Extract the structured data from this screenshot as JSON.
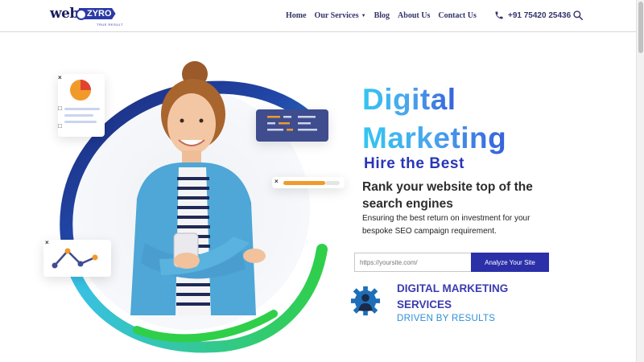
{
  "logo": {
    "part1": "web",
    "part2": "ZYRO",
    "tagline": "TRUE RESULT"
  },
  "nav": {
    "home": "Home",
    "services": "Our Services",
    "blog": "Blog",
    "about": "About Us",
    "contact": "Contact Us",
    "phone": "+91 75420 25436",
    "icons": {
      "phone": "phone-icon",
      "search": "search-icon",
      "caret": "caret-down-icon"
    }
  },
  "hero": {
    "title_line1": "Digital",
    "title_line2": "Marketing",
    "hire": "Hire the Best",
    "headline": "Rank your website top of the search engines",
    "description": "Ensuring the best return on investment for your bespoke SEO campaign requirement.",
    "url_placeholder": "https://yoursite.com/",
    "analyze_label": "Analyze Your Site",
    "service_title": "DIGITAL MARKETING SERVICES",
    "service_subtitle": "DRIVEN BY RESULTS"
  },
  "colors": {
    "brand_blue": "#2b2fa8",
    "title_gradient_start": "#33c6f0",
    "title_gradient_end": "#3660d9",
    "service_title": "#3b3bb0",
    "service_subtitle": "#2f8fd8",
    "art_navy": "#1e2a78",
    "art_cyan": "#39c2ec",
    "art_green": "#2fcf4a"
  }
}
